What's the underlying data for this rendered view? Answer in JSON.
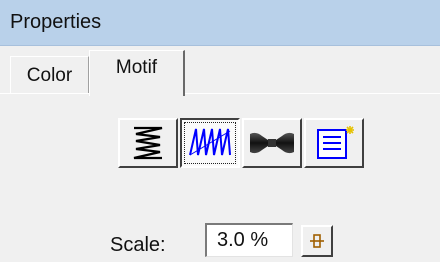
{
  "window": {
    "title": "Properties"
  },
  "tabs": [
    {
      "label": "Color",
      "active": false
    },
    {
      "label": "Motif",
      "active": true
    }
  ],
  "motif_tools": [
    {
      "icon": "zigzag-icon",
      "active": false
    },
    {
      "icon": "wave-icon",
      "active": true
    },
    {
      "icon": "bowtie-icon",
      "active": false
    },
    {
      "icon": "document-icon",
      "active": false
    }
  ],
  "scale": {
    "label": "Scale:",
    "value": "3.0 %"
  },
  "colors": {
    "titlebar": "#b9d1ea",
    "panel": "#f0f0f0",
    "active_icon": "#0000ff"
  }
}
